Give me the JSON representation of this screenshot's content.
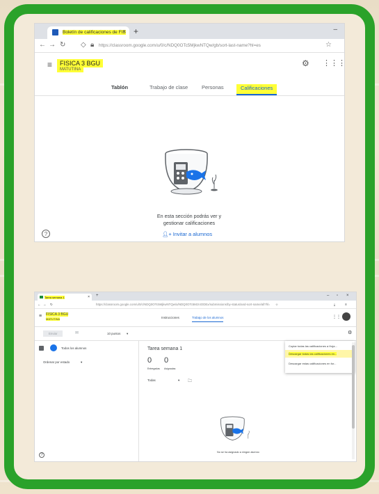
{
  "shot1": {
    "tab_title": "Boletín de calificaciones de FIS",
    "new_tab": "+",
    "url": "https://classroom.google.com/u/0/c/NDQ0OTc5MjkwNTQw/gb/sort-last-name?hl=es",
    "course_title": "FISICA 3 BGU",
    "course_subtitle": "MATUTINA",
    "tabs": [
      "Tablón",
      "Trabajo de clase",
      "Personas",
      "Calificaciones"
    ],
    "empty_line1": "En esta sección podrás ver y",
    "empty_line2": "gestionar calificaciones",
    "invite": "Invitar a alumnos",
    "help": "?"
  },
  "shot2": {
    "tab_title": "Tarea semana 1",
    "url": "https://classroom.google.com/u/0/c/NDQ0OTc5MjkwNTQw/a/NDQ0OTc5MzI4ODEx/submissions/by-status/and-sort-name/all?hl=es",
    "course_title": "FISICA 3 BGU",
    "course_subtitle": "MATUTINA",
    "tabs": [
      "Instrucciones",
      "Trabajo de los alumnos"
    ],
    "return_button": "Enviar",
    "points": "10 puntos",
    "all_students": "Todos los alumnos",
    "sort_label": "Ordenar por estado",
    "assignment_title": "Tarea semana 1",
    "turned_in_count": "0",
    "turned_in_label": "Entregadas",
    "assigned_count": "0",
    "assigned_label": "Asignadas",
    "filter": "Todas",
    "menu_items": [
      "Copiar todas las calificaciones a Hoja...",
      "Descargar todas las calificaciones en...",
      "Descargar estas calificaciones en for..."
    ],
    "empty_text": "No se ha asignado a ningún alumno",
    "help": "?"
  },
  "colors": {
    "frame_green": "#2aa22a",
    "highlight": "#ffff36",
    "classroom_blue": "#1967d2",
    "bowl_teal": "#1a73e8"
  }
}
